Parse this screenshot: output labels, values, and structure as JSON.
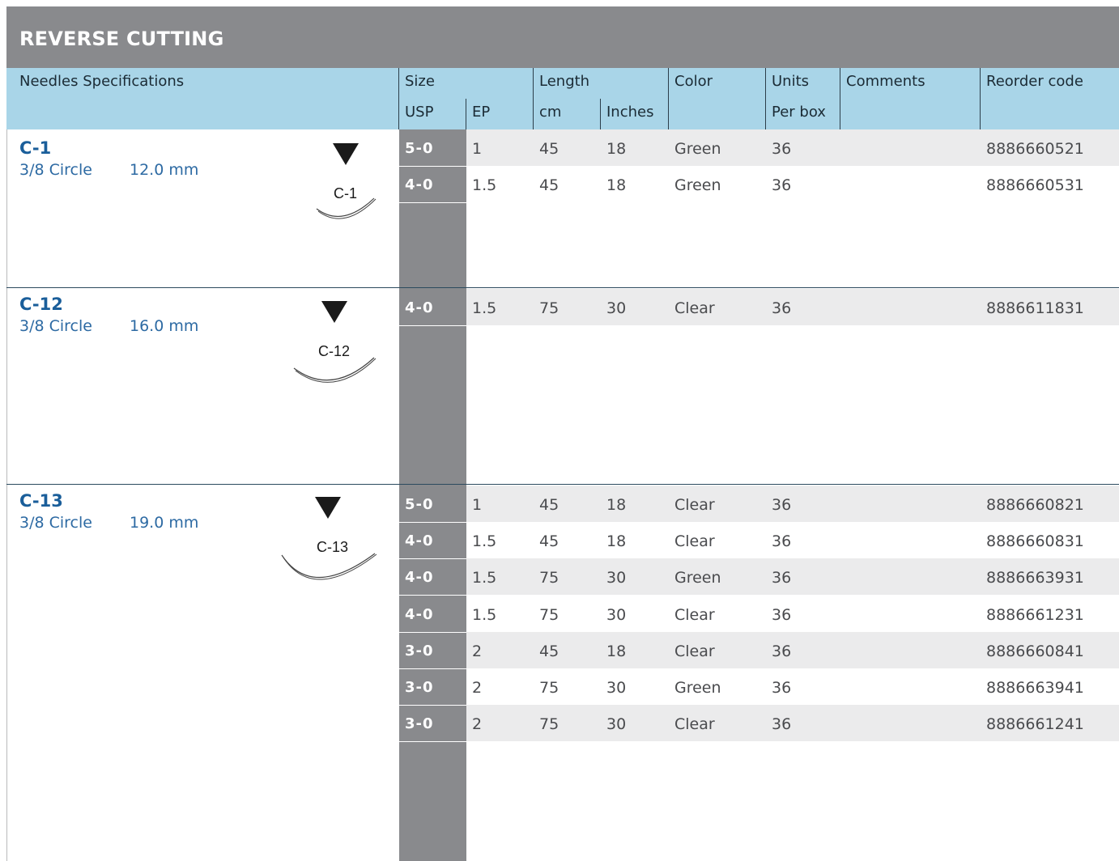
{
  "title": "REVERSE CUTTING",
  "header": {
    "needles_spec": "Needles Specifications",
    "size": "Size",
    "length": "Length",
    "color": "Color",
    "units": "Units",
    "comments": "Comments",
    "reorder": "Reorder code",
    "usp": "USP",
    "ep": "EP",
    "cm": "cm",
    "inches": "Inches",
    "per_box": "Per box"
  },
  "needles": [
    {
      "name": "C-1",
      "curve": "3/8 Circle",
      "size_mm": "12.0 mm",
      "label": "C-1"
    },
    {
      "name": "C-12",
      "curve": "3/8 Circle",
      "size_mm": "16.0 mm",
      "label": "C-12"
    },
    {
      "name": "C-13",
      "curve": "3/8 Circle",
      "size_mm": "19.0 mm",
      "label": "C-13"
    }
  ],
  "rows": [
    {
      "usp": "5-0",
      "ep": "1",
      "cm": "45",
      "in": "18",
      "color": "Green",
      "units": "36",
      "code": "8886660521"
    },
    {
      "usp": "4-0",
      "ep": "1.5",
      "cm": "45",
      "in": "18",
      "color": "Green",
      "units": "36",
      "code": "8886660531"
    },
    {
      "usp": "4-0",
      "ep": "1.5",
      "cm": "75",
      "in": "30",
      "color": "Clear",
      "units": "36",
      "code": "8886611831"
    },
    {
      "usp": "5-0",
      "ep": "1",
      "cm": "45",
      "in": "18",
      "color": "Clear",
      "units": "36",
      "code": "8886660821"
    },
    {
      "usp": "4-0",
      "ep": "1.5",
      "cm": "45",
      "in": "18",
      "color": "Clear",
      "units": "36",
      "code": "8886660831"
    },
    {
      "usp": "4-0",
      "ep": "1.5",
      "cm": "75",
      "in": "30",
      "color": "Green",
      "units": "36",
      "code": "8886663931"
    },
    {
      "usp": "4-0",
      "ep": "1.5",
      "cm": "75",
      "in": "30",
      "color": "Clear",
      "units": "36",
      "code": "8886661231"
    },
    {
      "usp": "3-0",
      "ep": "2",
      "cm": "45",
      "in": "18",
      "color": "Clear",
      "units": "36",
      "code": "8886660841"
    },
    {
      "usp": "3-0",
      "ep": "2",
      "cm": "75",
      "in": "30",
      "color": "Green",
      "units": "36",
      "code": "8886663941"
    },
    {
      "usp": "3-0",
      "ep": "2",
      "cm": "75",
      "in": "30",
      "color": "Clear",
      "units": "36",
      "code": "8886661241"
    }
  ]
}
